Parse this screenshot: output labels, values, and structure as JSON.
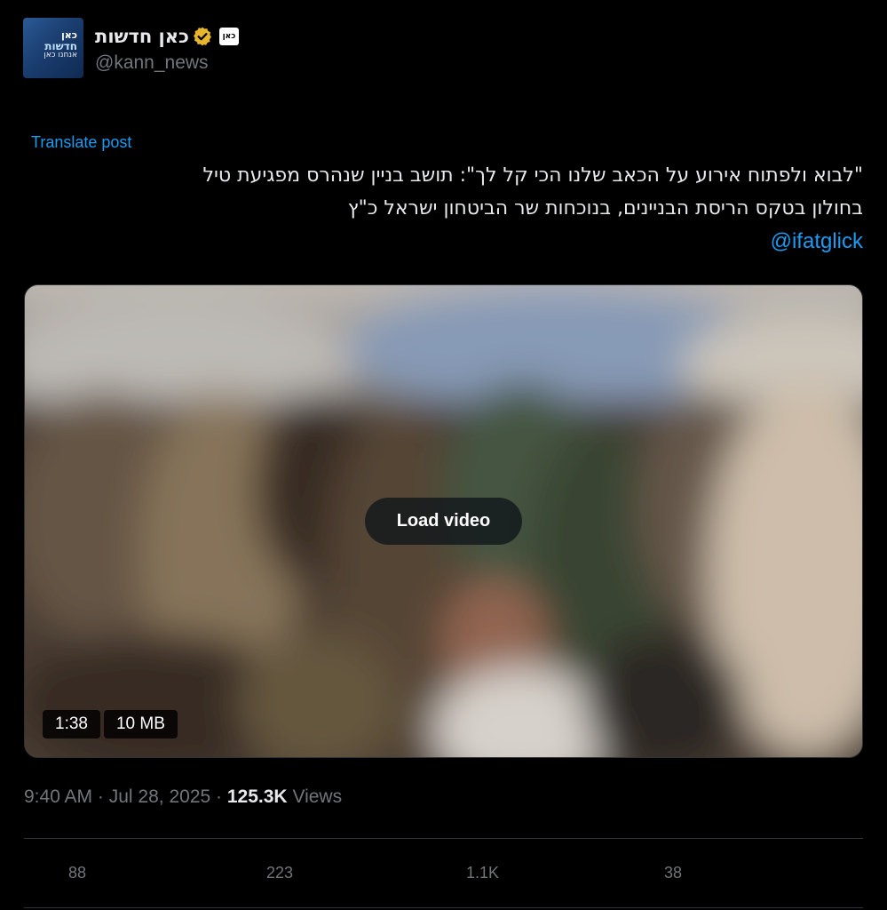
{
  "author": {
    "display_name": "כאן חדשות",
    "handle": "@kann_news",
    "avatar_text": [
      "כאן",
      "חדשות",
      "אנחנו כאן"
    ],
    "affiliate_label": "כאן",
    "verified_icon": "gold-verified-badge-icon",
    "verified_color": "#e8b62c"
  },
  "post": {
    "translate_label": "Translate post",
    "text_lines": [
      "\"לבוא ולפתוח אירוע על הכאב שלנו הכי קל לך\": תושב בניין שנהרס מפגיעת טיל",
      "בחולון בטקס הריסת הבניינים, בנוכחות שר הביטחון ישראל כ\"ץ"
    ],
    "mention": "@ifatglick"
  },
  "media": {
    "load_label": "Load video",
    "duration": "1:38",
    "size": "10 MB"
  },
  "meta": {
    "time": "9:40 AM",
    "separator": "·",
    "date": "Jul 28, 2025",
    "views_count": "125.3K",
    "views_label": "Views"
  },
  "actions": {
    "replies": "88",
    "reposts": "223",
    "likes": "1.1K",
    "bookmarks": "38"
  },
  "colors": {
    "background": "#000000",
    "text": "#e7e9ea",
    "muted": "#71767b",
    "link": "#1d9bf0",
    "border": "#2f3336"
  }
}
